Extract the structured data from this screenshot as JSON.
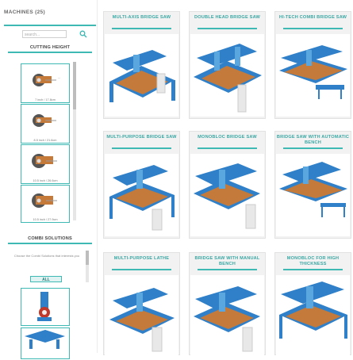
{
  "sidebar": {
    "title": "MACHINES (25)",
    "search_placeholder": "search...",
    "cutting_height": {
      "header": "CUTTING HEIGHT",
      "items": [
        {
          "caption": "7 inch / 17.8cm"
        },
        {
          "caption": "8.5 inch / 21.6cm"
        },
        {
          "caption": "10.5 inch / 26.6cm"
        },
        {
          "caption": "10.5 inch / 27.9cm"
        }
      ]
    },
    "combi": {
      "header": "COMBI SOLUTIONS",
      "description": "Choose the Combi Solutions that interests you",
      "all_label": "ALL"
    }
  },
  "machines": [
    {
      "title": "MULTI-AXIS BRIDGE SAW"
    },
    {
      "title": "DOUBLE HEAD BRIDGE SAW"
    },
    {
      "title": "HI-TECH COMBI BRIDGE SAW"
    },
    {
      "title": "MULTI-PURPOSE BRIDGE SAW"
    },
    {
      "title": "MONOBLOC BRIDGE SAW"
    },
    {
      "title": "BRIDGE SAW WITH AUTOMATIC BENCH"
    },
    {
      "title": "MULTI-PURPOSE LATHE"
    },
    {
      "title": "BRIDGE SAW WITH MANUAL BENCH"
    },
    {
      "title": "MONOBLOC FOR HIGH THICKNESS"
    }
  ],
  "colors": {
    "accent": "#3fb9b4",
    "machine_blue": "#2f80c8",
    "card_bg": "#f2f2f2"
  },
  "icons": {
    "search": "search-icon"
  }
}
